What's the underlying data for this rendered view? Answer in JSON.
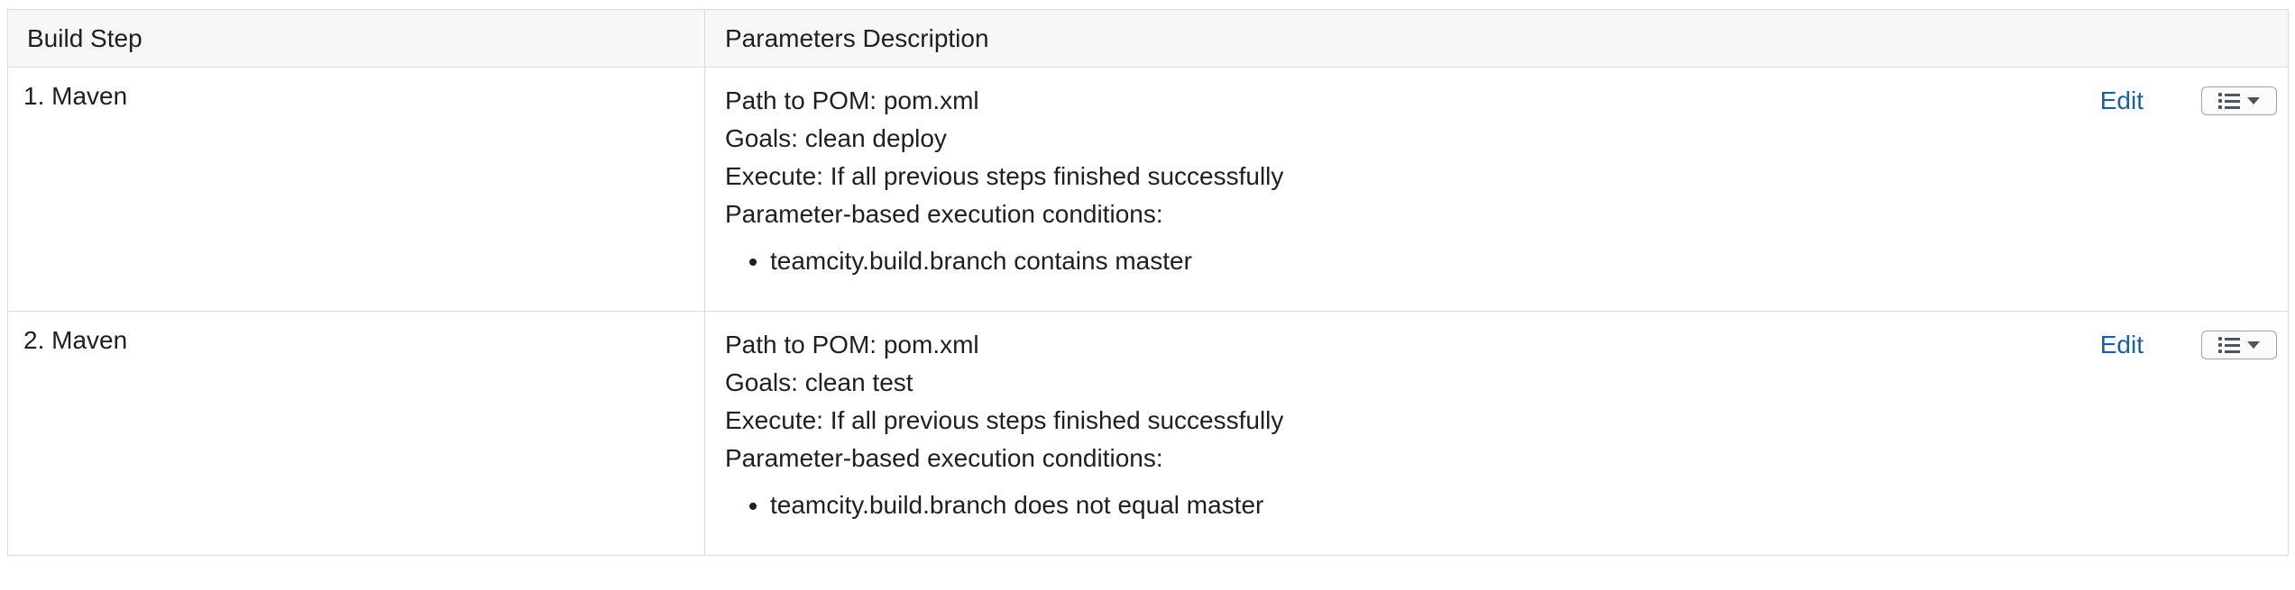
{
  "table": {
    "headers": {
      "step": "Build Step",
      "params": "Parameters Description"
    },
    "rows": [
      {
        "step": "1. Maven",
        "lines": [
          "Path to POM: pom.xml",
          "Goals: clean deploy",
          "Execute: If all previous steps finished successfully",
          "Parameter-based execution conditions:"
        ],
        "conditions": [
          "teamcity.build.branch contains master"
        ],
        "edit_label": "Edit"
      },
      {
        "step": "2. Maven",
        "lines": [
          "Path to POM: pom.xml",
          "Goals: clean test",
          "Execute: If all previous steps finished successfully",
          "Parameter-based execution conditions:"
        ],
        "conditions": [
          "teamcity.build.branch does not equal master"
        ],
        "edit_label": "Edit"
      }
    ]
  },
  "icons": {
    "menu": "list-icon",
    "dropdown": "caret-down-icon"
  },
  "colors": {
    "link": "#1b5fa0",
    "border": "#d8dbe0",
    "header_bg": "#f6f7f9"
  }
}
